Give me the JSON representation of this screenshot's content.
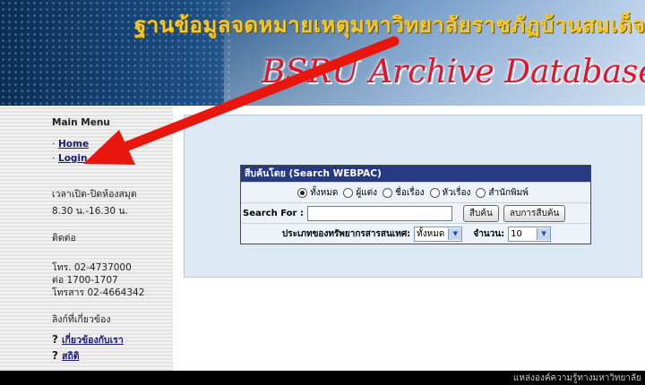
{
  "header": {
    "thai_title": "ฐานข้อมูลจดหมายเหตุมหาวิทยาลัยราชภัฏบ้านสมเด็จเจ้าพระยา",
    "english_title": "BSRU Archive Database"
  },
  "sidebar": {
    "main_menu_title": "Main Menu",
    "menu_items": [
      {
        "label": "Home"
      },
      {
        "label": "Login"
      }
    ],
    "hours_title": "เวลาเปิด-ปิดห้องสมุด",
    "hours_value": "8.30 น.-16.30 น.",
    "contact_title": "ติดต่อ",
    "contact_lines": [
      "โทร. 02-4737000",
      "ต่อ 1700-1707",
      "โทรสาร 02-4664342"
    ],
    "links_title": "ลิงก์ที่เกี่ยวข้อง",
    "links": [
      {
        "label": "เกี่ยวข้องกับเรา"
      },
      {
        "label": "สถิติ"
      }
    ]
  },
  "search": {
    "header": "สืบค้นโดย (Search WEBPAC)",
    "options": [
      {
        "label": "ทั้งหมด",
        "selected": true
      },
      {
        "label": "ผู้แต่ง",
        "selected": false
      },
      {
        "label": "ชื่อเรื่อง",
        "selected": false
      },
      {
        "label": "หัวเรื่อง",
        "selected": false
      },
      {
        "label": "สำนักพิมพ์",
        "selected": false
      }
    ],
    "search_for_label": "Search For :",
    "search_value": "",
    "search_button": "สืบค้น",
    "clear_button": "ลบการสืบค้น",
    "resource_type_label": "ประเภทของทรัพยากรสารสนเทศ:",
    "resource_type_value": "ทั้งหมด",
    "count_label": "จำนวน:",
    "count_value": "10"
  },
  "footer": {
    "text": "แหล่งองค์ความรู้ทางมหาวิทยาลัย"
  },
  "colors": {
    "annotation_arrow": "#e8160c",
    "form_header": "#253a82",
    "panel_bg": "#dde9f5"
  }
}
